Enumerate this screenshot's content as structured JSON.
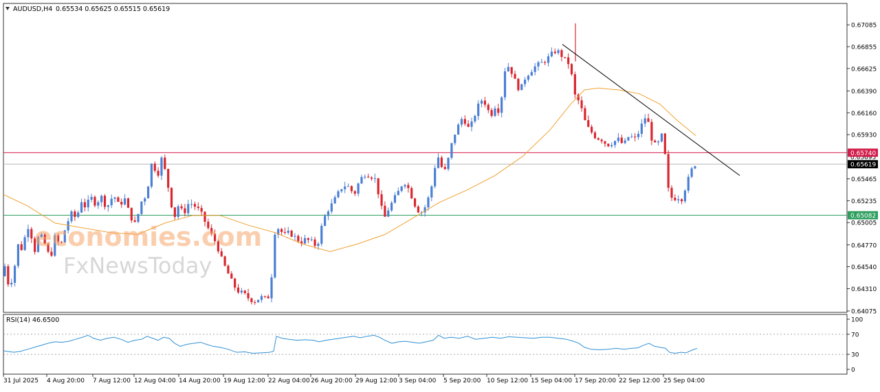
{
  "header": {
    "symbol": "AUDUSD,H4",
    "ohlc": "0.65534 0.65625 0.65515 0.65619"
  },
  "rsi_header": "RSI(14) 46.6500",
  "watermark": {
    "line1": "economies.com",
    "line2": "FxNewsToday"
  },
  "colors": {
    "bull": "#4a7fd4",
    "bear": "#d9262e",
    "ma": "#f0a030",
    "resistance": "#d21c4a",
    "support": "#2e9e5e",
    "price_line": "#b4b4b4",
    "trendline": "#000000",
    "rsi_line": "#2e8fd6"
  },
  "chart_data": [
    {
      "type": "candlestick",
      "title": "AUDUSD,H4",
      "y_ticks": [
        "0.67085",
        "0.66855",
        "0.66625",
        "0.66390",
        "0.66160",
        "0.65930",
        "0.65465",
        "0.65235",
        "0.65005",
        "0.64770",
        "0.64540",
        "0.64310",
        "0.64075"
      ],
      "ylim": [
        0.64075,
        0.6718
      ],
      "x_ticks": [
        "31 Jul 2025",
        "4 Aug 20:00",
        "7 Aug 12:00",
        "12 Aug 04:00",
        "14 Aug 20:00",
        "19 Aug 12:00",
        "22 Aug 04:00",
        "26 Aug 20:00",
        "29 Aug 12:00",
        "3 Sep 04:00",
        "5 Sep 20:00",
        "10 Sep 12:00",
        "15 Sep 04:00",
        "17 Sep 20:00",
        "22 Sep 12:00",
        "25 Sep 04:00"
      ],
      "price_labels": [
        {
          "value": "0.65695",
          "y": 0.65695,
          "kind": "ghost"
        },
        {
          "value": "0.65740",
          "y": 0.6574,
          "kind": "resistance"
        },
        {
          "value": "0.65619",
          "y": 0.65619,
          "kind": "current"
        },
        {
          "value": "0.65082",
          "y": 0.65082,
          "kind": "support"
        }
      ],
      "horizontal_levels": {
        "resistance": 0.6574,
        "current": 0.65619,
        "support": 0.65082
      },
      "path": [
        [
          0,
          0.6466
        ],
        [
          6,
          0.6442
        ],
        [
          12,
          0.6455
        ],
        [
          18,
          0.6432
        ],
        [
          24,
          0.6445
        ],
        [
          32,
          0.648
        ],
        [
          38,
          0.647
        ],
        [
          44,
          0.65
        ],
        [
          50,
          0.6488
        ],
        [
          56,
          0.647
        ],
        [
          62,
          0.649
        ],
        [
          70,
          0.6478
        ],
        [
          78,
          0.6462
        ],
        [
          86,
          0.649
        ],
        [
          92,
          0.6472
        ],
        [
          100,
          0.6495
        ],
        [
          108,
          0.651
        ],
        [
          116,
          0.6505
        ],
        [
          124,
          0.6525
        ],
        [
          130,
          0.6515
        ],
        [
          136,
          0.6528
        ],
        [
          144,
          0.652
        ],
        [
          152,
          0.6528
        ],
        [
          160,
          0.6516
        ],
        [
          170,
          0.653
        ],
        [
          178,
          0.6518
        ],
        [
          186,
          0.6526
        ],
        [
          194,
          0.6508
        ],
        [
          202,
          0.6498
        ],
        [
          210,
          0.6522
        ],
        [
          218,
          0.653
        ],
        [
          226,
          0.6565
        ],
        [
          234,
          0.655
        ],
        [
          240,
          0.6568
        ],
        [
          246,
          0.6552
        ],
        [
          252,
          0.6528
        ],
        [
          258,
          0.6505
        ],
        [
          264,
          0.6518
        ],
        [
          272,
          0.651
        ],
        [
          280,
          0.6522
        ],
        [
          288,
          0.6518
        ],
        [
          296,
          0.6512
        ],
        [
          304,
          0.65
        ],
        [
          312,
          0.6488
        ],
        [
          320,
          0.6478
        ],
        [
          328,
          0.646
        ],
        [
          336,
          0.6448
        ],
        [
          344,
          0.6435
        ],
        [
          352,
          0.6428
        ],
        [
          360,
          0.6425
        ],
        [
          368,
          0.642
        ],
        [
          376,
          0.6418
        ],
        [
          384,
          0.6422
        ],
        [
          392,
          0.642
        ],
        [
          398,
          0.6425
        ],
        [
          404,
          0.649
        ],
        [
          410,
          0.6495
        ],
        [
          418,
          0.6487
        ],
        [
          426,
          0.649
        ],
        [
          434,
          0.6485
        ],
        [
          442,
          0.648
        ],
        [
          450,
          0.6483
        ],
        [
          458,
          0.648
        ],
        [
          466,
          0.6475
        ],
        [
          474,
          0.65
        ],
        [
          480,
          0.6512
        ],
        [
          488,
          0.652
        ],
        [
          496,
          0.653
        ],
        [
          504,
          0.654
        ],
        [
          512,
          0.6538
        ],
        [
          520,
          0.653
        ],
        [
          528,
          0.6545
        ],
        [
          536,
          0.6552
        ],
        [
          544,
          0.655
        ],
        [
          552,
          0.6545
        ],
        [
          558,
          0.652
        ],
        [
          564,
          0.6505
        ],
        [
          570,
          0.6515
        ],
        [
          578,
          0.6525
        ],
        [
          586,
          0.6535
        ],
        [
          592,
          0.6545
        ],
        [
          600,
          0.6535
        ],
        [
          608,
          0.652
        ],
        [
          616,
          0.651
        ],
        [
          622,
          0.6515
        ],
        [
          630,
          0.653
        ],
        [
          636,
          0.655
        ],
        [
          640,
          0.6575
        ],
        [
          646,
          0.656
        ],
        [
          652,
          0.6555
        ],
        [
          658,
          0.657
        ],
        [
          664,
          0.659
        ],
        [
          670,
          0.66
        ],
        [
          678,
          0.6612
        ],
        [
          686,
          0.66
        ],
        [
          692,
          0.6605
        ],
        [
          698,
          0.662
        ],
        [
          706,
          0.663
        ],
        [
          712,
          0.6625
        ],
        [
          718,
          0.6612
        ],
        [
          726,
          0.6625
        ],
        [
          732,
          0.6615
        ],
        [
          738,
          0.666
        ],
        [
          744,
          0.6665
        ],
        [
          750,
          0.6658
        ],
        [
          756,
          0.6645
        ],
        [
          762,
          0.664
        ],
        [
          768,
          0.6652
        ],
        [
          776,
          0.666
        ],
        [
          784,
          0.6665
        ],
        [
          792,
          0.6668
        ],
        [
          800,
          0.6672
        ],
        [
          808,
          0.6678
        ],
        [
          814,
          0.6682
        ],
        [
          820,
          0.6678
        ],
        [
          826,
          0.6672
        ],
        [
          832,
          0.6668
        ],
        [
          838,
          0.665
        ],
        [
          842,
          0.663
        ],
        [
          848,
          0.6628
        ],
        [
          854,
          0.661
        ],
        [
          860,
          0.66
        ],
        [
          866,
          0.6595
        ],
        [
          872,
          0.659
        ],
        [
          880,
          0.6588
        ],
        [
          888,
          0.6582
        ],
        [
          896,
          0.6585
        ],
        [
          904,
          0.6588
        ],
        [
          912,
          0.6582
        ],
        [
          920,
          0.6592
        ],
        [
          928,
          0.6588
        ],
        [
          936,
          0.6598
        ],
        [
          942,
          0.6612
        ],
        [
          948,
          0.6605
        ],
        [
          954,
          0.6585
        ],
        [
          960,
          0.658
        ],
        [
          966,
          0.659
        ],
        [
          970,
          0.6595
        ],
        [
          974,
          0.655
        ],
        [
          978,
          0.653
        ],
        [
          984,
          0.6525
        ],
        [
          990,
          0.6528
        ],
        [
          996,
          0.6525
        ],
        [
          1002,
          0.6538
        ],
        [
          1008,
          0.655
        ],
        [
          1014,
          0.6562
        ]
      ],
      "moving_average": {
        "points": [
          [
            5,
            0.653
          ],
          [
            40,
            0.6518
          ],
          [
            80,
            0.65
          ],
          [
            120,
            0.6495
          ],
          [
            160,
            0.649
          ],
          [
            200,
            0.6488
          ],
          [
            240,
            0.65
          ],
          [
            280,
            0.6508
          ],
          [
            320,
            0.6508
          ],
          [
            360,
            0.6498
          ],
          [
            400,
            0.649
          ],
          [
            440,
            0.6478
          ],
          [
            480,
            0.647
          ],
          [
            520,
            0.6478
          ],
          [
            560,
            0.6488
          ],
          [
            600,
            0.6505
          ],
          [
            640,
            0.6522
          ],
          [
            680,
            0.6535
          ],
          [
            720,
            0.655
          ],
          [
            760,
            0.657
          ],
          [
            800,
            0.6598
          ],
          [
            830,
            0.6625
          ],
          [
            850,
            0.664
          ],
          [
            870,
            0.6642
          ],
          [
            900,
            0.664
          ],
          [
            930,
            0.6636
          ],
          [
            960,
            0.6625
          ],
          [
            985,
            0.6608
          ],
          [
            1012,
            0.6592
          ]
        ]
      },
      "trendline": {
        "points": [
          [
            818,
            0.6688
          ],
          [
            1076,
            0.655
          ]
        ]
      }
    },
    {
      "type": "line",
      "title": "RSI(14) 46.6500",
      "y_ticks": [
        "100",
        "70",
        "30",
        "0"
      ],
      "levels": [
        70,
        30
      ],
      "ylim": [
        0,
        100
      ],
      "values": [
        [
          5,
          37
        ],
        [
          20,
          34
        ],
        [
          30,
          36
        ],
        [
          40,
          40
        ],
        [
          50,
          44
        ],
        [
          60,
          48
        ],
        [
          70,
          52
        ],
        [
          80,
          55
        ],
        [
          90,
          54
        ],
        [
          100,
          56
        ],
        [
          110,
          60
        ],
        [
          120,
          64
        ],
        [
          128,
          68
        ],
        [
          136,
          62
        ],
        [
          146,
          58
        ],
        [
          156,
          62
        ],
        [
          166,
          64
        ],
        [
          176,
          60
        ],
        [
          186,
          54
        ],
        [
          196,
          58
        ],
        [
          206,
          60
        ],
        [
          214,
          66
        ],
        [
          222,
          62
        ],
        [
          230,
          58
        ],
        [
          238,
          64
        ],
        [
          246,
          62
        ],
        [
          254,
          52
        ],
        [
          262,
          46
        ],
        [
          272,
          50
        ],
        [
          282,
          52
        ],
        [
          292,
          54
        ],
        [
          300,
          50
        ],
        [
          310,
          46
        ],
        [
          320,
          44
        ],
        [
          332,
          40
        ],
        [
          344,
          34
        ],
        [
          356,
          35
        ],
        [
          368,
          32
        ],
        [
          380,
          33
        ],
        [
          392,
          34
        ],
        [
          398,
          36
        ],
        [
          402,
          66
        ],
        [
          410,
          62
        ],
        [
          420,
          60
        ],
        [
          432,
          58
        ],
        [
          444,
          59
        ],
        [
          456,
          58
        ],
        [
          464,
          55
        ],
        [
          474,
          58
        ],
        [
          484,
          60
        ],
        [
          494,
          62
        ],
        [
          504,
          64
        ],
        [
          514,
          66
        ],
        [
          524,
          63
        ],
        [
          534,
          66
        ],
        [
          544,
          68
        ],
        [
          552,
          64
        ],
        [
          560,
          58
        ],
        [
          570,
          52
        ],
        [
          580,
          55
        ],
        [
          590,
          56
        ],
        [
          600,
          54
        ],
        [
          610,
          52
        ],
        [
          620,
          55
        ],
        [
          630,
          58
        ],
        [
          638,
          68
        ],
        [
          646,
          62
        ],
        [
          656,
          64
        ],
        [
          668,
          62
        ],
        [
          680,
          66
        ],
        [
          692,
          60
        ],
        [
          704,
          62
        ],
        [
          716,
          64
        ],
        [
          728,
          62
        ],
        [
          740,
          65
        ],
        [
          752,
          64
        ],
        [
          764,
          63
        ],
        [
          776,
          62
        ],
        [
          788,
          64
        ],
        [
          800,
          64
        ],
        [
          812,
          62
        ],
        [
          824,
          60
        ],
        [
          834,
          56
        ],
        [
          842,
          52
        ],
        [
          850,
          44
        ],
        [
          860,
          40
        ],
        [
          872,
          39
        ],
        [
          884,
          40
        ],
        [
          896,
          42
        ],
        [
          908,
          40
        ],
        [
          918,
          42
        ],
        [
          928,
          43
        ],
        [
          936,
          48
        ],
        [
          944,
          52
        ],
        [
          952,
          46
        ],
        [
          960,
          44
        ],
        [
          968,
          42
        ],
        [
          974,
          34
        ],
        [
          982,
          32
        ],
        [
          990,
          34
        ],
        [
          998,
          33
        ],
        [
          1006,
          38
        ],
        [
          1014,
          42
        ]
      ]
    }
  ]
}
